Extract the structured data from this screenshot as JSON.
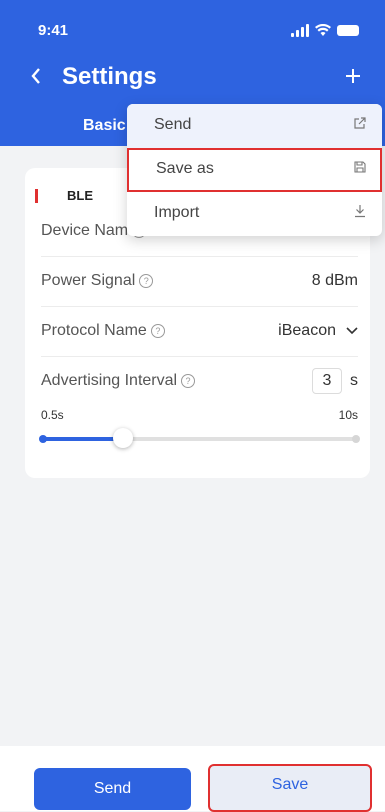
{
  "status": {
    "time": "9:41"
  },
  "header": {
    "back_icon": "chevron-left-icon",
    "title": "Settings",
    "add_icon": "plus-icon",
    "tab": "Basic"
  },
  "menu": {
    "items": [
      {
        "label": "Send",
        "icon": "external-link-icon"
      },
      {
        "label": "Save as",
        "icon": "save-icon"
      },
      {
        "label": "Import",
        "icon": "download-icon"
      }
    ]
  },
  "ble": {
    "section_title": "BLE",
    "device_name": {
      "label": "Device Nam",
      "value": "1..."
    },
    "power_signal": {
      "label": "Power Signal",
      "value": "8 dBm"
    },
    "protocol_name": {
      "label": "Protocol Name",
      "value": "iBeacon"
    },
    "advertising_interval": {
      "label": "Advertising Interval",
      "value": "3",
      "unit": "s"
    },
    "slider": {
      "min_label": "0.5s",
      "max_label": "10s",
      "level": 0.26
    }
  },
  "footer": {
    "send_label": "Send",
    "save_label": "Save"
  },
  "colors": {
    "accent": "#2e63e0",
    "highlight": "#e03030"
  }
}
